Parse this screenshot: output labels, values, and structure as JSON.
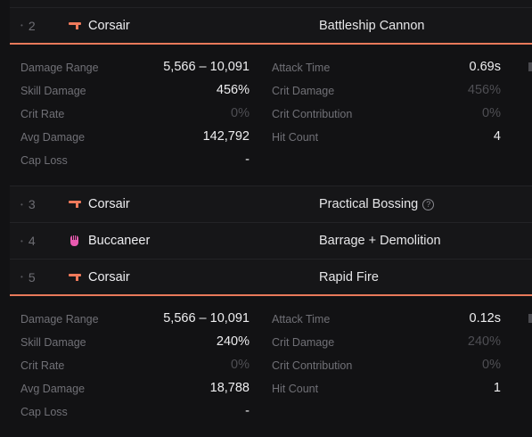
{
  "rows": [
    {
      "rank": "2",
      "class_name": "Corsair",
      "class_icon": "corsair-icon",
      "skill": "Battleship Cannon",
      "expanded": true,
      "stats": {
        "damage_range_label": "Damage Range",
        "damage_range": "5,566 – 10,091",
        "attack_time_label": "Attack Time",
        "attack_time": "0.69s",
        "skill_damage_label": "Skill Damage",
        "skill_damage": "456%",
        "crit_damage_label": "Crit Damage",
        "crit_damage": "456%",
        "crit_rate_label": "Crit Rate",
        "crit_rate": "0%",
        "crit_contribution_label": "Crit Contribution",
        "crit_contribution": "0%",
        "avg_damage_label": "Avg Damage",
        "avg_damage": "142,792",
        "hit_count_label": "Hit Count",
        "hit_count": "4",
        "cap_loss_label": "Cap Loss",
        "cap_loss": "-"
      }
    },
    {
      "rank": "3",
      "class_name": "Corsair",
      "class_icon": "corsair-icon",
      "skill": "Practical Bossing",
      "help": "?"
    },
    {
      "rank": "4",
      "class_name": "Buccaneer",
      "class_icon": "buccaneer-icon",
      "skill": "Barrage + Demolition"
    },
    {
      "rank": "5",
      "class_name": "Corsair",
      "class_icon": "corsair-icon",
      "skill": "Rapid Fire",
      "expanded": true,
      "stats": {
        "damage_range_label": "Damage Range",
        "damage_range": "5,566 – 10,091",
        "attack_time_label": "Attack Time",
        "attack_time": "0.12s",
        "skill_damage_label": "Skill Damage",
        "skill_damage": "240%",
        "crit_damage_label": "Crit Damage",
        "crit_damage": "240%",
        "crit_rate_label": "Crit Rate",
        "crit_rate": "0%",
        "crit_contribution_label": "Crit Contribution",
        "crit_contribution": "0%",
        "avg_damage_label": "Avg Damage",
        "avg_damage": "18,788",
        "hit_count_label": "Hit Count",
        "hit_count": "1",
        "cap_loss_label": "Cap Loss",
        "cap_loss": "-"
      }
    }
  ],
  "colors": {
    "corsair": "#ef7a5b",
    "buccaneer": "#e95ab0",
    "accent_line": "#e8795a"
  }
}
